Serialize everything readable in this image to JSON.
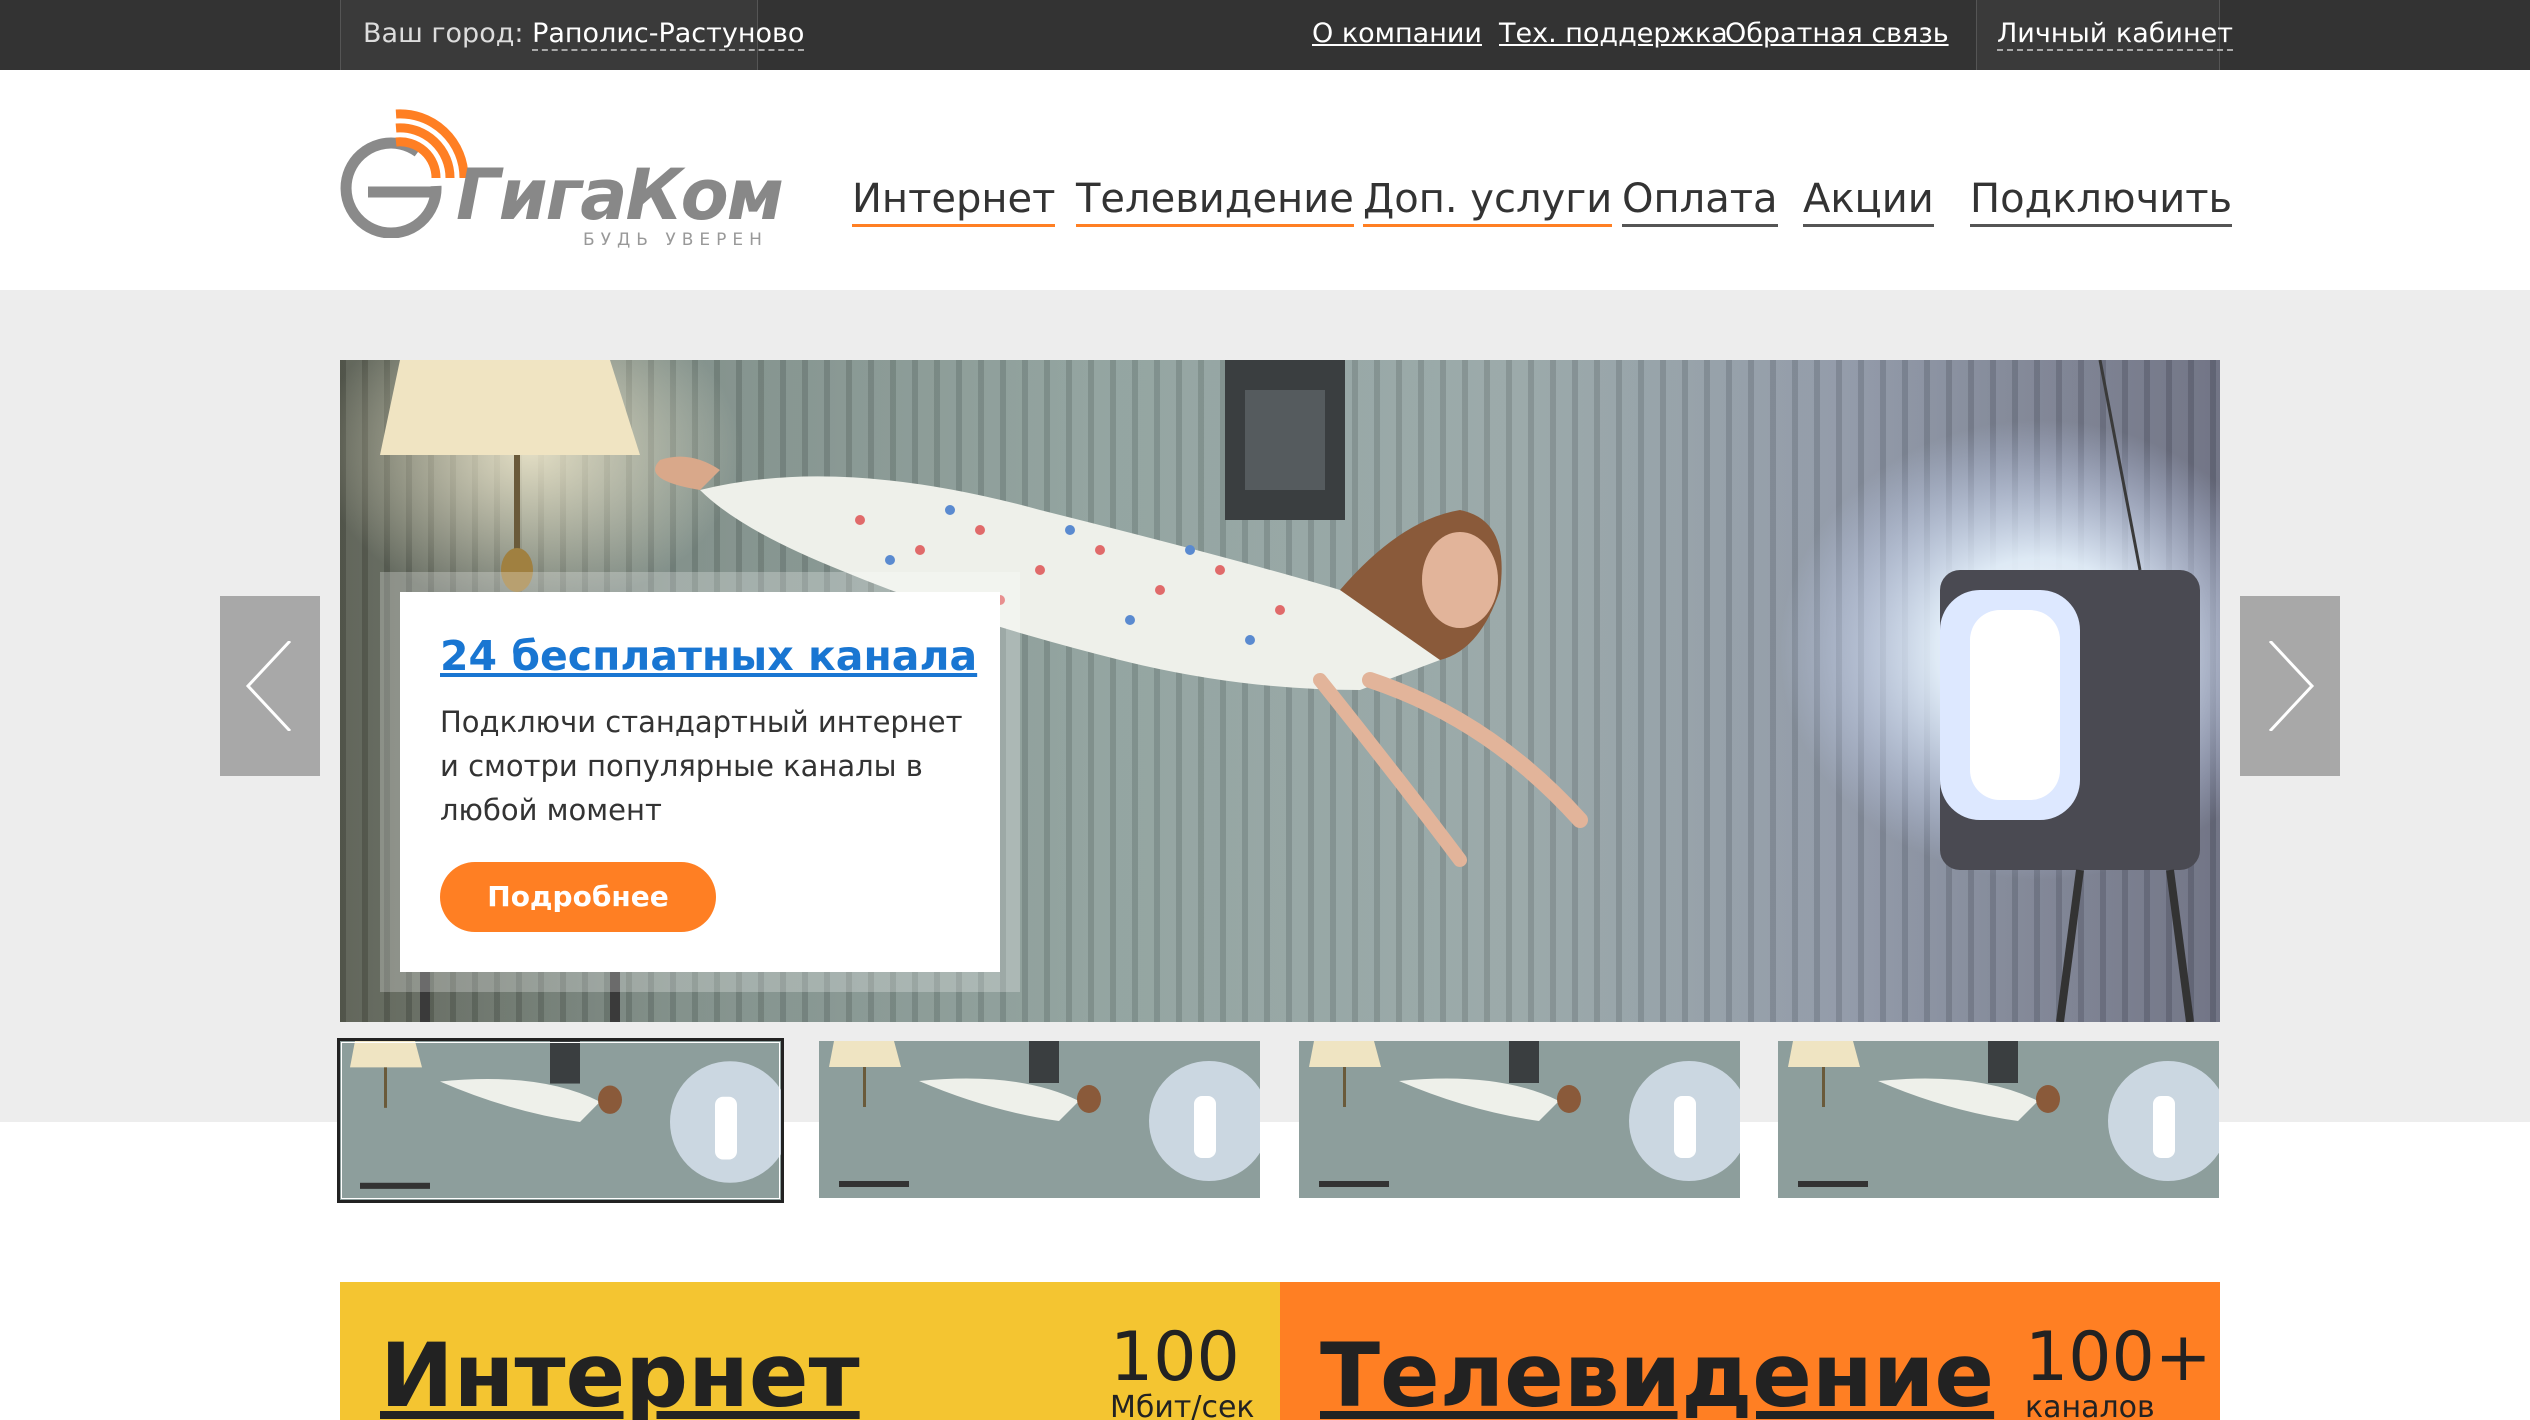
{
  "topbar": {
    "city_prefix": "Ваш город:",
    "city_name": "Раполис-Растуново",
    "links": [
      "О компании",
      "Тех. поддержка",
      "Обратная связь"
    ],
    "cabinet": "Личный кабинет"
  },
  "logo": {
    "name": "ГигаКом",
    "tagline": "БУДЬ УВЕРЕН"
  },
  "nav": [
    "Интернет",
    "Телевидение",
    "Доп. услуги",
    "Оплата",
    "Акции",
    "Подключить"
  ],
  "slider": {
    "title": "24 бесплатных канала",
    "text": "Подключи стандартный интернет и смотри популярные каналы в любой момент",
    "button": "Подробнее",
    "thumbnail_count": 4,
    "active_thumbnail": 1
  },
  "services": [
    {
      "title": "Интернет",
      "value": "100",
      "unit": "Мбит/сек"
    },
    {
      "title": "Телевидение",
      "value": "100+",
      "unit": "каналов"
    }
  ],
  "colors": {
    "topbar": "#333333",
    "accent_orange": "#ff7f23",
    "accent_yellow": "#f4c531",
    "link_blue": "#1976d2",
    "slider_bg": "#ededed"
  }
}
